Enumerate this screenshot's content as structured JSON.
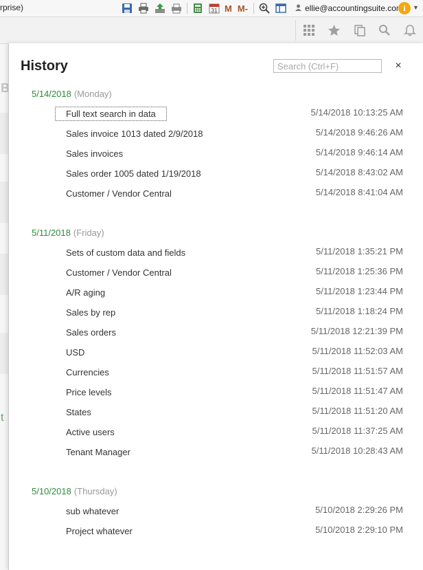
{
  "window": {
    "title_fragment": "rprise)",
    "user_email": "ellie@accountingsuite.com",
    "toolbar_text_buttons": [
      "M",
      "M-"
    ]
  },
  "icons": {
    "toolbar": [
      "save-icon",
      "print-icon",
      "upload-icon",
      "print-preview-icon",
      "calculator-icon",
      "calendar-icon",
      "m-button",
      "m-minus-button",
      "zoom-icon",
      "panel-icon",
      "user-icon",
      "info-icon",
      "dropdown-caret-icon"
    ],
    "secondbar": [
      "apps-grid-icon",
      "star-icon",
      "copy-icon",
      "search-icon",
      "bell-icon"
    ],
    "calendar_day": "31"
  },
  "colors": {
    "date_green": "#2e8b3c",
    "weekday_gray": "#999999",
    "info_orange": "#f0a913"
  },
  "history": {
    "title": "History",
    "search_placeholder": "Search (Ctrl+F)",
    "close_glyph": "×",
    "groups": [
      {
        "date": "5/14/2018",
        "weekday": "(Monday)",
        "entries": [
          {
            "label": "Full text search in data",
            "time": "5/14/2018 10:13:25 AM"
          },
          {
            "label": "Sales invoice 1013 dated 2/9/2018",
            "time": "5/14/2018 9:46:26 AM"
          },
          {
            "label": "Sales invoices",
            "time": "5/14/2018 9:46:14 AM"
          },
          {
            "label": "Sales order 1005 dated 1/19/2018",
            "time": "5/14/2018 8:43:02 AM"
          },
          {
            "label": "Customer / Vendor Central",
            "time": "5/14/2018 8:41:04 AM"
          }
        ]
      },
      {
        "date": "5/11/2018",
        "weekday": "(Friday)",
        "entries": [
          {
            "label": "Sets of custom data and fields",
            "time": "5/11/2018 1:35:21 PM"
          },
          {
            "label": "Customer / Vendor Central",
            "time": "5/11/2018 1:25:36 PM"
          },
          {
            "label": "A/R aging",
            "time": "5/11/2018 1:23:44 PM"
          },
          {
            "label": "Sales by rep",
            "time": "5/11/2018 1:18:24 PM"
          },
          {
            "label": "Sales orders",
            "time": "5/11/2018 12:21:39 PM"
          },
          {
            "label": "USD",
            "time": "5/11/2018 11:52:03 AM"
          },
          {
            "label": "Currencies",
            "time": "5/11/2018 11:51:57 AM"
          },
          {
            "label": "Price levels",
            "time": "5/11/2018 11:51:47 AM"
          },
          {
            "label": "States",
            "time": "5/11/2018 11:51:20 AM"
          },
          {
            "label": "Active users",
            "time": "5/11/2018 11:37:25 AM"
          },
          {
            "label": "Tenant Manager",
            "time": "5/11/2018 10:28:43 AM"
          }
        ]
      },
      {
        "date": "5/10/2018",
        "weekday": "(Thursday)",
        "entries": [
          {
            "label": "sub whatever",
            "time": "5/10/2018 2:29:26 PM"
          },
          {
            "label": "Project whatever",
            "time": "5/10/2018 2:29:10 PM"
          }
        ]
      }
    ]
  }
}
